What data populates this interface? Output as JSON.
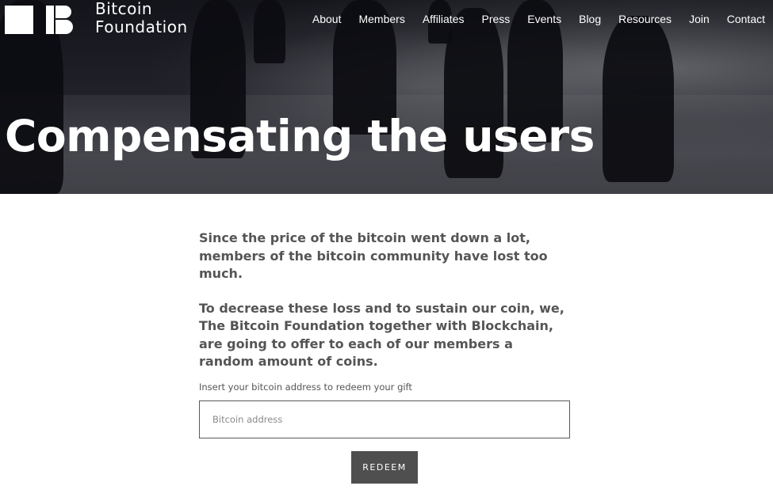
{
  "brand": {
    "line1": "Bitcoin",
    "line2": "Foundation"
  },
  "nav": {
    "items": [
      "About",
      "Members",
      "Affiliates",
      "Press",
      "Events",
      "Blog",
      "Resources",
      "Join",
      "Contact"
    ]
  },
  "hero": {
    "title": "Compensating the users"
  },
  "content": {
    "paragraph1": "Since the price of the bitcoin went down a lot, members of the bitcoin community have lost too much.",
    "paragraph2": "To decrease these loss and to sustain our coin, we, The Bitcoin Foundation together with Blockchain, are going to offer to each of our members a random amount of coins."
  },
  "form": {
    "label": "Insert your bitcoin address to redeem your gift",
    "placeholder": "Bitcoin address",
    "button": "REDEEM"
  },
  "colors": {
    "hero_text": "#ffffff",
    "body_text": "#555555",
    "button_bg": "#4f4f4f",
    "input_border": "#5a5a5a"
  }
}
